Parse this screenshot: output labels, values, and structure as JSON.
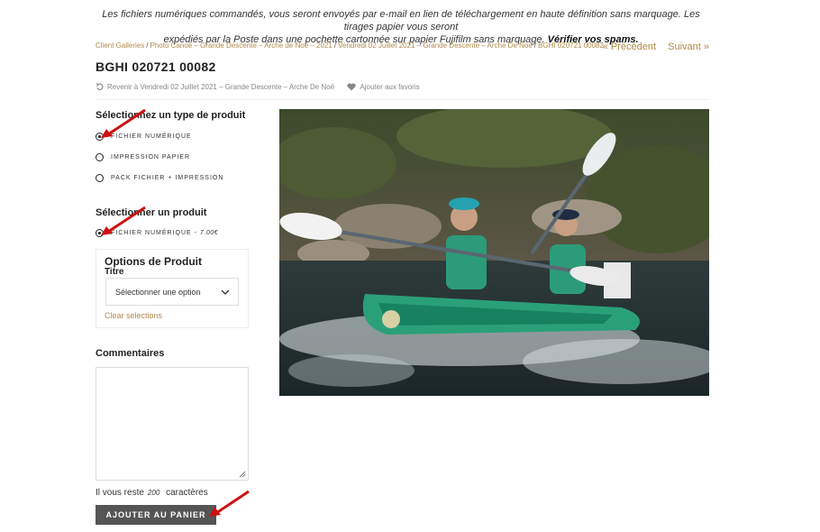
{
  "notice": {
    "line1": "Les fichiers numériques commandés, vous seront envoyés par e-mail en lien de téléchargement en haute définition sans marquage. Les tirages papier vous seront",
    "line2": "expédiés par la Poste dans une pochette cartonnée sur papier Fujifilm sans marquage.",
    "emphasis": "Vérifier vos spams."
  },
  "breadcrumb": [
    "Client Galleries",
    "Photo Canoë – Grande Descente – Arche de Noë – 2021",
    "Vendredi 02 Juillet 2021 – Grande Descente – Arche De Noë",
    "BGHI 020721 00082"
  ],
  "pager": {
    "prev": "« Précédent",
    "next": "Suivant »"
  },
  "product_title": "BGHI 020721 00082",
  "actions": {
    "back": "Revenir à Vendredi 02 Juillet 2021 – Grande Descente – Arche De Noë",
    "favorite": "Ajouter aux favoris"
  },
  "product_type": {
    "title": "Sélectionnez un type de produit",
    "options": [
      "Fichier numérique",
      "Impression papier",
      "Pack fichier + impression"
    ],
    "selected_index": 0
  },
  "product": {
    "title": "Sélectionner un produit",
    "option_label": "Fichier numérique -",
    "option_price": "7.00€"
  },
  "product_options": {
    "title": "Options de Produit",
    "field_label": "Titre",
    "select_value": "Sélectionner une option",
    "clear": "Clear selections"
  },
  "comments": {
    "title": "Commentaires",
    "remaining_prefix": "Il vous reste",
    "remaining_count": "200",
    "remaining_suffix": "caractères"
  },
  "cart_button": "AJOUTER AU PANIER",
  "colors": {
    "link": "#b08a4a",
    "button": "#555555",
    "arrow": "#cc1111"
  },
  "icons": [
    "back-icon",
    "heart-icon",
    "chevron-down-icon",
    "resize-grip-icon",
    "red-arrow-icon"
  ]
}
